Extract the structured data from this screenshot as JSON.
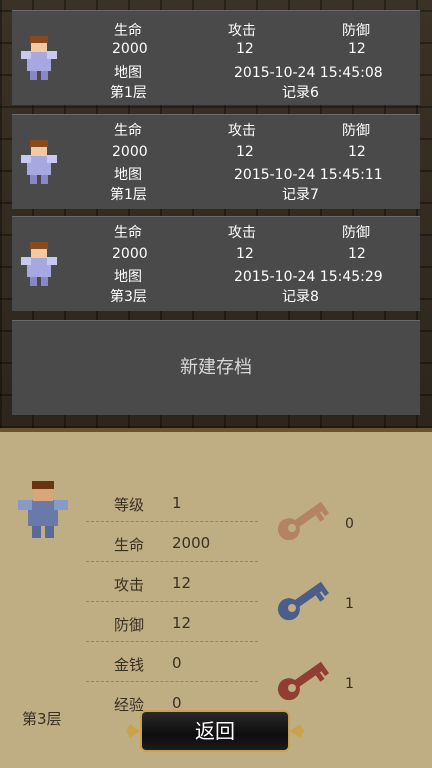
{
  "slots": [
    {
      "hp_label": "生命",
      "atk_label": "攻击",
      "def_label": "防御",
      "hp": "2000",
      "atk": "12",
      "def": "12",
      "map_label": "地图",
      "timestamp": "2015-10-24 15:45:08",
      "floor": "第1层",
      "record": "记录6"
    },
    {
      "hp_label": "生命",
      "atk_label": "攻击",
      "def_label": "防御",
      "hp": "2000",
      "atk": "12",
      "def": "12",
      "map_label": "地图",
      "timestamp": "2015-10-24 15:45:11",
      "floor": "第1层",
      "record": "记录7"
    },
    {
      "hp_label": "生命",
      "atk_label": "攻击",
      "def_label": "防御",
      "hp": "2000",
      "atk": "12",
      "def": "12",
      "map_label": "地图",
      "timestamp": "2015-10-24 15:45:29",
      "floor": "第3层",
      "record": "记录8"
    }
  ],
  "new_save_label": "新建存档",
  "status": {
    "level_label": "等级",
    "level": "1",
    "hp_label": "生命",
    "hp": "2000",
    "atk_label": "攻击",
    "atk": "12",
    "def_label": "防御",
    "def": "12",
    "gold_label": "金钱",
    "gold": "0",
    "exp_label": "经验",
    "exp": "0",
    "floor": "第3层"
  },
  "keys": [
    {
      "color": "yellow",
      "icon": "yellow-key-icon",
      "count": "0",
      "hex": "#b07a5a"
    },
    {
      "color": "blue",
      "icon": "blue-key-icon",
      "count": "1",
      "hex": "#3a4f8a"
    },
    {
      "color": "red",
      "icon": "red-key-icon",
      "count": "1",
      "hex": "#8a2a24"
    }
  ],
  "back_label": "返回",
  "colors": {
    "slot_bg": "#4a4a4a",
    "panel_bg": "#bfae84",
    "button_border": "#c9a24a"
  }
}
